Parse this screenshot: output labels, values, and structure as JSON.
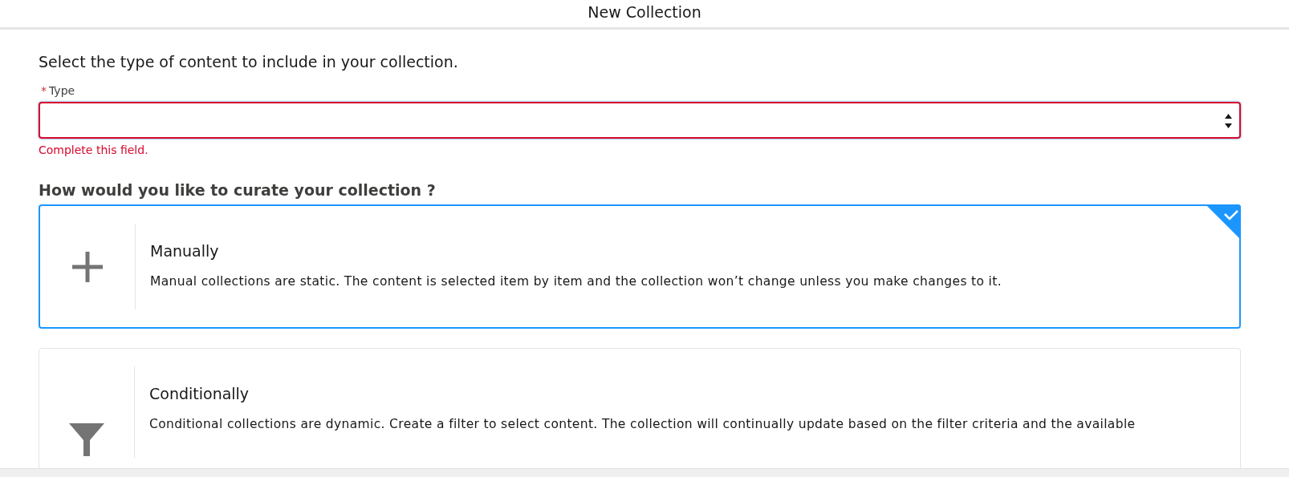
{
  "modal": {
    "title": "New Collection"
  },
  "intro": "Select the type of content to include in your collection.",
  "type_field": {
    "label": "Type",
    "required": true,
    "required_mark": "*",
    "invalid": true,
    "error": "Complete this field."
  },
  "curate_heading": "How would you like to curate your collection ?",
  "options": [
    {
      "kind": "manual",
      "title": "Manually",
      "description": "Manual collections are static. The content is selected item by item and the collection won’t change unless you make changes to it.",
      "selected": true
    },
    {
      "kind": "conditional",
      "title": "Conditionally",
      "description": "Conditional collections are dynamic. Create a filter to select content. The collection will continually update based on the filter criteria and the available",
      "selected": false
    }
  ]
}
